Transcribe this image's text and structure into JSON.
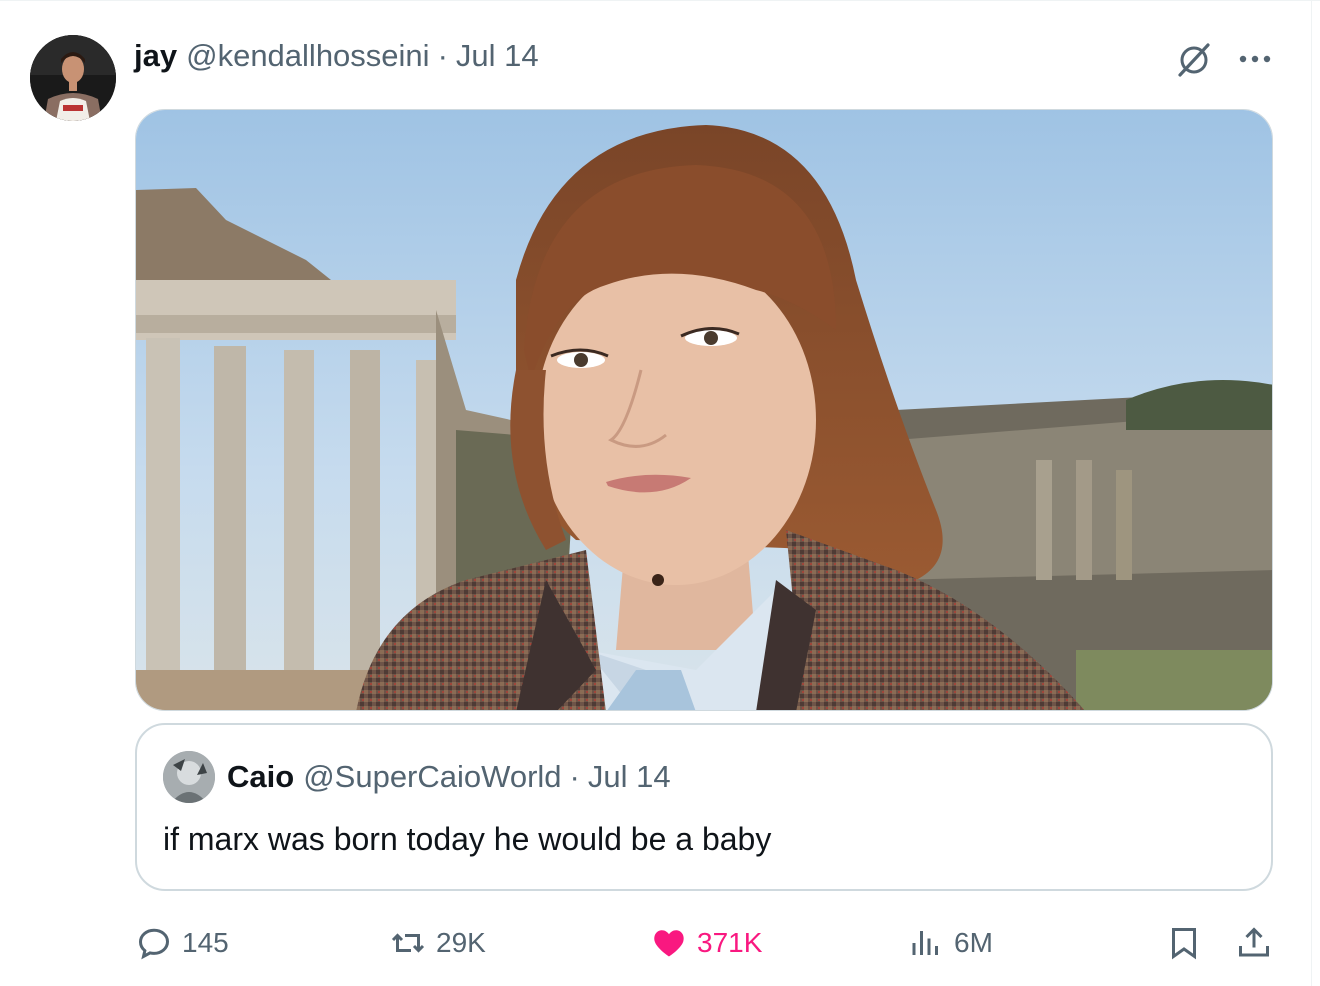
{
  "tweet": {
    "author_name": "jay",
    "author_handle": "@kendallhosseini",
    "separator": "·",
    "date": "Jul 14",
    "avatar_icon": "user-avatar-photo",
    "media_icon": "photo-woman-in-tweed-blazer-roman-ruins",
    "grok_icon": "grok-icon",
    "more_icon": "more-horizontal-icon"
  },
  "quote": {
    "author_name": "Caio",
    "author_handle": "@SuperCaioWorld",
    "separator": "·",
    "date": "Jul 14",
    "text": "if marx was born today he would be a baby"
  },
  "actions": {
    "replies": "145",
    "retweets": "29K",
    "likes": "371K",
    "views": "6M"
  },
  "colors": {
    "text_primary": "#0f1419",
    "text_secondary": "#536471",
    "like_pink": "#f91880",
    "border": "#cfd9de"
  }
}
